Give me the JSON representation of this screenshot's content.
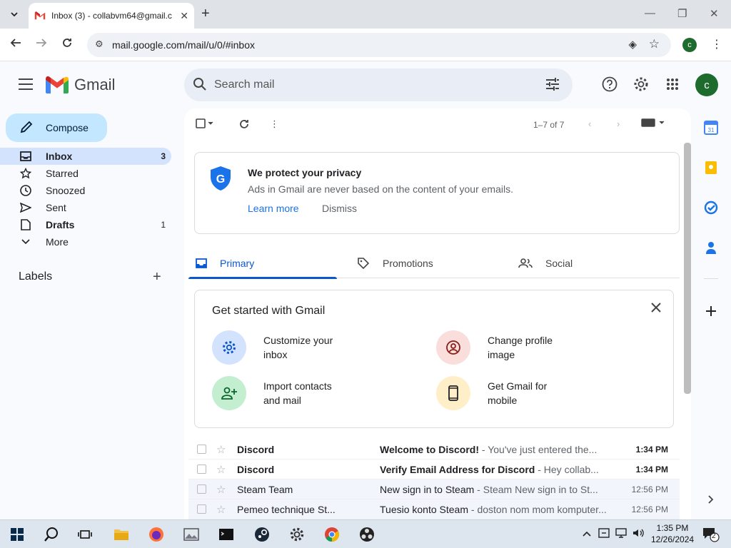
{
  "browser": {
    "tab_title": "Inbox (3) - collabvm64@gmail.c",
    "url": "mail.google.com/mail/u/0/#inbox",
    "profile_initial": "c"
  },
  "gmail": {
    "logo_text": "Gmail",
    "search_placeholder": "Search mail",
    "avatar_initial": "c",
    "compose_label": "Compose",
    "nav": [
      {
        "label": "Inbox",
        "count": "3",
        "icon": "inbox-icon"
      },
      {
        "label": "Starred",
        "count": "",
        "icon": "star-icon"
      },
      {
        "label": "Snoozed",
        "count": "",
        "icon": "clock-icon"
      },
      {
        "label": "Sent",
        "count": "",
        "icon": "send-icon"
      },
      {
        "label": "Drafts",
        "count": "1",
        "icon": "draft-icon"
      },
      {
        "label": "More",
        "count": "",
        "icon": "chevron-down-icon"
      }
    ],
    "labels_header": "Labels",
    "pager": "1–7 of 7",
    "privacy": {
      "title": "We protect your privacy",
      "subtitle": "Ads in Gmail are never based on the content of your emails.",
      "learn_more": "Learn more",
      "dismiss": "Dismiss"
    },
    "tabs": [
      {
        "label": "Primary",
        "icon": "inbox-tab-icon"
      },
      {
        "label": "Promotions",
        "icon": "tag-icon"
      },
      {
        "label": "Social",
        "icon": "people-icon"
      }
    ],
    "get_started": {
      "title": "Get started with Gmail",
      "cards": [
        {
          "line1": "Customize your",
          "line2": "inbox",
          "icon": "gear-icon"
        },
        {
          "line1": "Change profile",
          "line2": "image",
          "icon": "account-icon"
        },
        {
          "line1": "Import contacts",
          "line2": "and mail",
          "icon": "person-add-icon"
        },
        {
          "line1": "Get Gmail for",
          "line2": "mobile",
          "icon": "phone-icon"
        }
      ]
    },
    "emails": [
      {
        "sender": "Discord",
        "subject": "Welcome to Discord!",
        "snippet": " - You've just entered the...",
        "time": "1:34 PM",
        "unread": true
      },
      {
        "sender": "Discord",
        "subject": "Verify Email Address for Discord",
        "snippet": " - Hey collab...",
        "time": "1:34 PM",
        "unread": true
      },
      {
        "sender": "Steam Team",
        "subject": "New sign in to Steam",
        "snippet": " - Steam New sign in to St...",
        "time": "12:56 PM",
        "unread": false
      },
      {
        "sender": "Pemeo technique St...",
        "subject": "Tuesio konto Steam",
        "snippet": " - doston nom mom komputer...",
        "time": "12:56 PM",
        "unread": false
      }
    ]
  },
  "taskbar": {
    "time": "1:35 PM",
    "date": "12/26/2024",
    "notification_count": "2"
  },
  "colors": {
    "accent": "#0b57d0",
    "compose_bg": "#c2e7ff",
    "active_nav_bg": "#d3e3fd",
    "avatar_bg": "#1e6b2e"
  }
}
